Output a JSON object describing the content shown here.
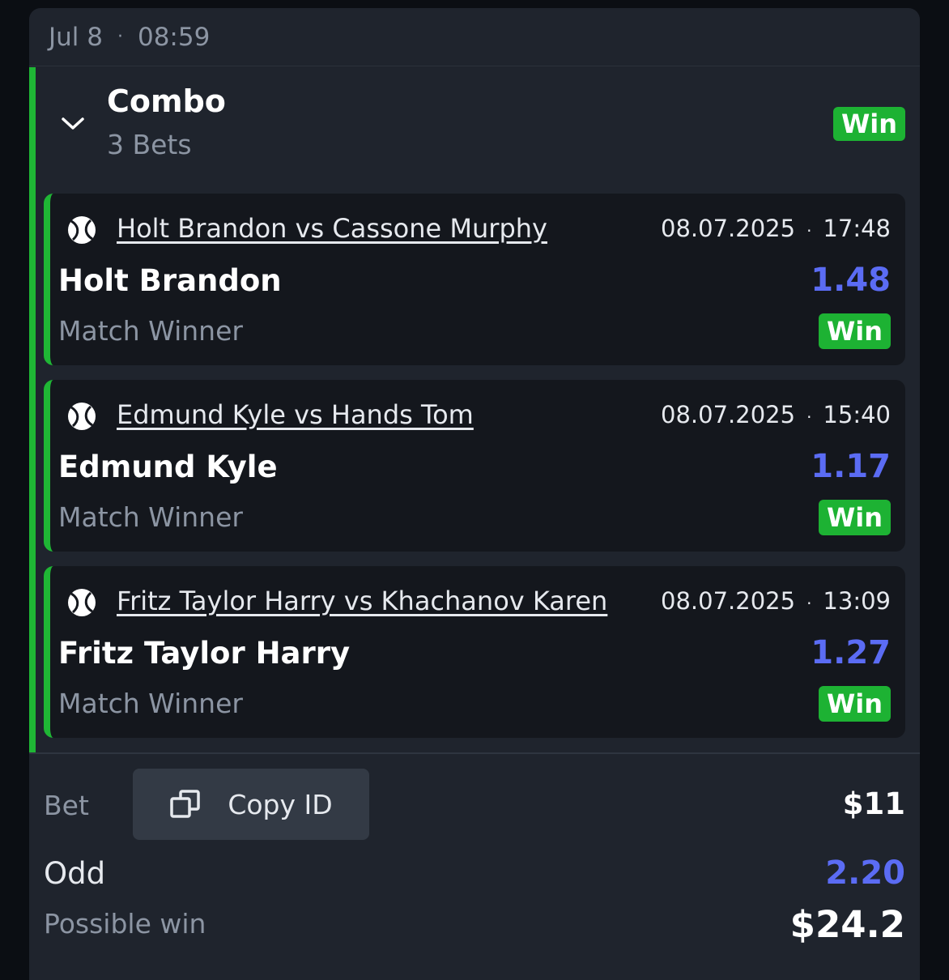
{
  "header": {
    "date": "Jul 8",
    "time": "08:59"
  },
  "combo": {
    "title": "Combo",
    "subtitle": "3 Bets",
    "status": "Win"
  },
  "bets": [
    {
      "sport_icon": "tennis-ball-icon",
      "match": "Holt Brandon vs Cassone Murphy",
      "date": "08.07.2025",
      "time": "17:48",
      "pick": "Holt Brandon",
      "odd": "1.48",
      "market": "Match Winner",
      "status": "Win"
    },
    {
      "sport_icon": "tennis-ball-icon",
      "match": "Edmund Kyle vs Hands Tom",
      "date": "08.07.2025",
      "time": "15:40",
      "pick": "Edmund Kyle",
      "odd": "1.17",
      "market": "Match Winner",
      "status": "Win"
    },
    {
      "sport_icon": "tennis-ball-icon",
      "match": "Fritz Taylor Harry vs Khachanov Karen",
      "date": "08.07.2025",
      "time": "13:09",
      "pick": "Fritz Taylor Harry",
      "odd": "1.27",
      "market": "Match Winner",
      "status": "Win"
    }
  ],
  "footer": {
    "bet_label": "Bet",
    "copy_label": "Copy ID",
    "bet_amount": "$11",
    "odd_label": "Odd",
    "odd_value": "2.20",
    "possible_win_label": "Possible win",
    "possible_win_value": "$24.2"
  },
  "colors": {
    "win": "#1db233",
    "odd": "#5b6cf4",
    "card": "#1f242d",
    "bet_card": "#14171d"
  }
}
